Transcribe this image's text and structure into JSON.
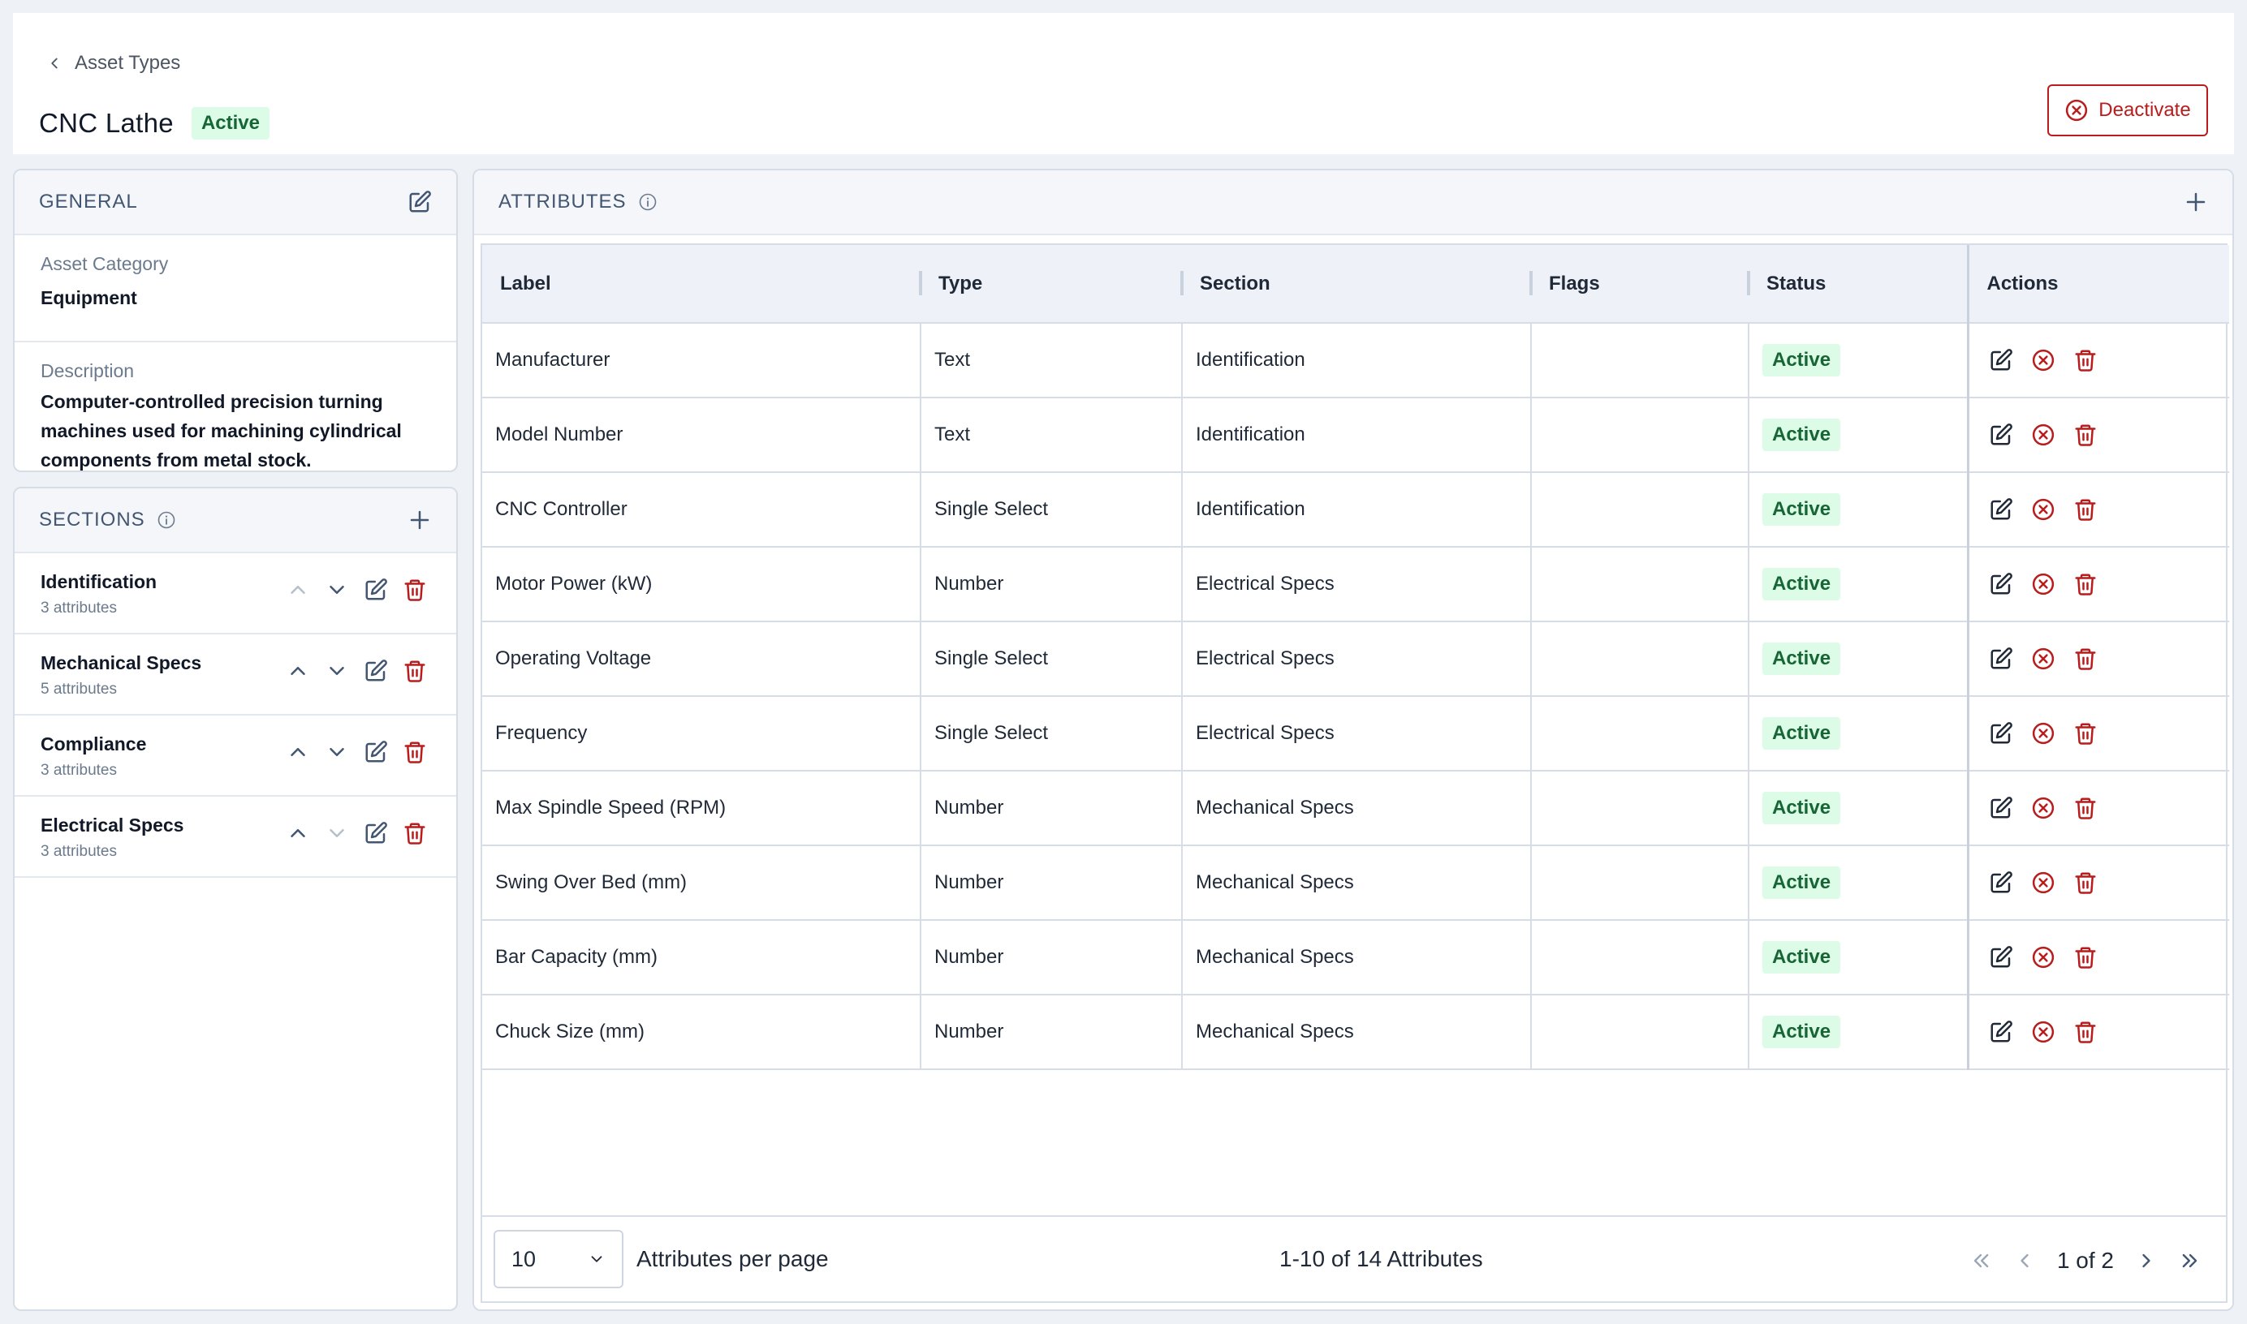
{
  "breadcrumb": {
    "label": "Asset Types"
  },
  "page": {
    "title": "CNC Lathe",
    "status": "Active"
  },
  "header_actions": {
    "deactivate_label": "Deactivate"
  },
  "general": {
    "title": "GENERAL",
    "category_label": "Asset Category",
    "category_value": "Equipment",
    "description_label": "Description",
    "description_value": "Computer-controlled precision turning machines used for machining cylindrical components from metal stock."
  },
  "sections": {
    "title": "SECTIONS",
    "items": [
      {
        "name": "Identification",
        "count": "3 attributes"
      },
      {
        "name": "Mechanical Specs",
        "count": "5 attributes"
      },
      {
        "name": "Compliance",
        "count": "3 attributes"
      },
      {
        "name": "Electrical Specs",
        "count": "3 attributes"
      }
    ]
  },
  "attributes": {
    "title": "ATTRIBUTES",
    "columns": [
      "Label",
      "Type",
      "Section",
      "Flags",
      "Status",
      "Actions"
    ],
    "rows": [
      {
        "label": "Manufacturer",
        "type": "Text",
        "section": "Identification",
        "flags": "",
        "status": "Active"
      },
      {
        "label": "Model Number",
        "type": "Text",
        "section": "Identification",
        "flags": "",
        "status": "Active"
      },
      {
        "label": "CNC Controller",
        "type": "Single Select",
        "section": "Identification",
        "flags": "",
        "status": "Active"
      },
      {
        "label": "Motor Power (kW)",
        "type": "Number",
        "section": "Electrical Specs",
        "flags": "",
        "status": "Active"
      },
      {
        "label": "Operating Voltage",
        "type": "Single Select",
        "section": "Electrical Specs",
        "flags": "",
        "status": "Active"
      },
      {
        "label": "Frequency",
        "type": "Single Select",
        "section": "Electrical Specs",
        "flags": "",
        "status": "Active"
      },
      {
        "label": "Max Spindle Speed (RPM)",
        "type": "Number",
        "section": "Mechanical Specs",
        "flags": "",
        "status": "Active"
      },
      {
        "label": "Swing Over Bed (mm)",
        "type": "Number",
        "section": "Mechanical Specs",
        "flags": "",
        "status": "Active"
      },
      {
        "label": "Bar Capacity (mm)",
        "type": "Number",
        "section": "Mechanical Specs",
        "flags": "",
        "status": "Active"
      },
      {
        "label": "Chuck Size (mm)",
        "type": "Number",
        "section": "Mechanical Specs",
        "flags": "",
        "status": "Active"
      }
    ]
  },
  "pagination": {
    "per_page_value": "10",
    "per_page_label": "Attributes per page",
    "range_label": "1-10 of 14 Attributes",
    "page_label": "1 of 2"
  },
  "colors": {
    "active_bg": "#dcfce7",
    "active_text": "#166534",
    "danger": "#b91c1c",
    "edit_icon": "#1f2937"
  }
}
